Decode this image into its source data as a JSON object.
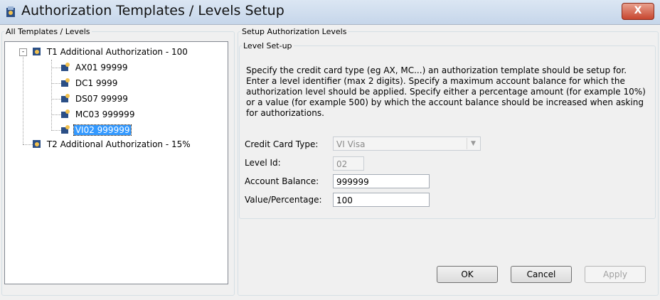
{
  "window": {
    "title": "Authorization Templates / Levels Setup",
    "close_label": "X"
  },
  "left_panel": {
    "legend": "All Templates / Levels",
    "expander": "-",
    "tree": [
      {
        "code": "T1",
        "label": "Additional Authorization - 100",
        "level": 0
      },
      {
        "code": "AX01",
        "label": "99999",
        "level": 1
      },
      {
        "code": "DC1",
        "label": "9999",
        "level": 1
      },
      {
        "code": "DS07",
        "label": "99999",
        "level": 1
      },
      {
        "code": "MC03",
        "label": "999999",
        "level": 1
      },
      {
        "code": "VI02",
        "label": "999999",
        "level": 1,
        "selected": true
      },
      {
        "code": "T2",
        "label": "Additional Authorization - 15%",
        "level": 0
      }
    ],
    "tree_text": {
      "t1": "T1  Additional Authorization - 100",
      "ax01": "AX01  99999",
      "dc1": "DC1  9999",
      "ds07": "DS07  99999",
      "mc03": "MC03  999999",
      "vi02": "VI02  999999",
      "t2": "T2  Additional Authorization - 15%"
    }
  },
  "right_panel": {
    "legend": "Setup Authorization Levels",
    "inner_legend": "Level Set-up",
    "description": "Specify the credit card type (eg AX, MC...) an authorization template should be setup for. Enter a level identifier (max 2 digits). Specify a maximum account balance for which the authorization level should be applied. Specify either a percentage amount (for example 10%) or a value (for example 500) by which the account balance should be increased when asking for authorizations.",
    "fields": {
      "credit_card_type_label": "Credit Card Type:",
      "credit_card_type_value": "VI Visa",
      "level_id_label": "Level Id:",
      "level_id_value": "02",
      "account_balance_label": "Account Balance:",
      "account_balance_value": "999999",
      "value_percentage_label": "Value/Percentage:",
      "value_percentage_value": "100"
    }
  },
  "buttons": {
    "ok": "OK",
    "cancel": "Cancel",
    "apply": "Apply"
  },
  "colors": {
    "selection": "#3399ff",
    "close": "#c7462f"
  }
}
